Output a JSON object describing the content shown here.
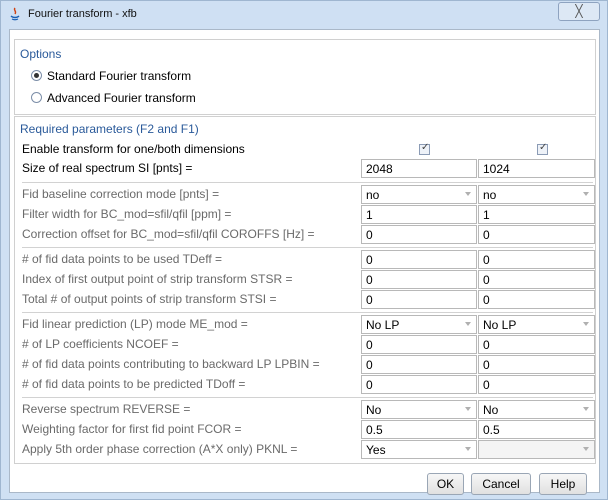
{
  "window": {
    "title": "Fourier transform - xfb",
    "close_glyph": "╳"
  },
  "options": {
    "heading": "Options",
    "radios": [
      {
        "label": "Standard Fourier transform",
        "selected": true
      },
      {
        "label": "Advanced Fourier transform",
        "selected": false
      }
    ]
  },
  "params": {
    "heading": "Required parameters (F2 and F1)",
    "enable_label": "Enable transform for one/both dimensions",
    "enable_f2": true,
    "enable_f1": true,
    "rows": [
      {
        "label": "Size of real spectrum SI [pnts] =",
        "f2": "2048",
        "f1": "1024"
      },
      {
        "label": "Fid baseline correction mode [pnts] =",
        "f2": "no",
        "f1": "no"
      },
      {
        "label": "Filter width for BC_mod=sfil/qfil [ppm] =",
        "f2": "1",
        "f1": "1"
      },
      {
        "label": "Correction offset for BC_mod=sfil/qfil COROFFS [Hz] =",
        "f2": "0",
        "f1": "0"
      },
      {
        "label": "# of fid data points to be used TDeff =",
        "f2": "0",
        "f1": "0"
      },
      {
        "label": "Index of first output point of strip transform STSR =",
        "f2": "0",
        "f1": "0"
      },
      {
        "label": "Total # of output points of strip transform STSI =",
        "f2": "0",
        "f1": "0"
      },
      {
        "label": "Fid linear prediction (LP) mode ME_mod =",
        "f2": "No LP",
        "f1": "No LP"
      },
      {
        "label": "# of LP coefficients NCOEF =",
        "f2": "0",
        "f1": "0"
      },
      {
        "label": "# of fid data points contributing to backward LP LPBIN =",
        "f2": "0",
        "f1": "0"
      },
      {
        "label": "# of fid data points to be predicted TDoff =",
        "f2": "0",
        "f1": "0"
      },
      {
        "label": "Reverse spectrum REVERSE =",
        "f2": "No",
        "f1": "No"
      },
      {
        "label": "Weighting factor for first fid point FCOR =",
        "f2": "0.5",
        "f1": "0.5"
      },
      {
        "label": "Apply 5th order phase correction (A*X only) PKNL =",
        "f2": "Yes",
        "f1": ""
      }
    ]
  },
  "buttons": {
    "ok": "OK",
    "cancel": "Cancel",
    "help": "Help"
  },
  "colors": {
    "heading": "#2a5a9a",
    "window_frame": "#cfe0f3"
  }
}
